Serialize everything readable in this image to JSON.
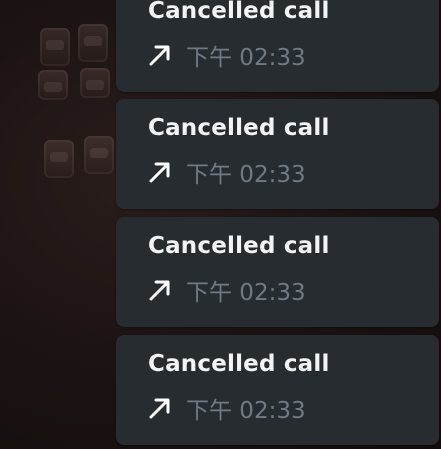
{
  "messages": [
    {
      "title": "Cancelled call",
      "time": "下午 02:33",
      "direction_icon": "outgoing-arrow-icon"
    },
    {
      "title": "Cancelled call",
      "time": "下午 02:33",
      "direction_icon": "outgoing-arrow-icon"
    },
    {
      "title": "Cancelled call",
      "time": "下午 02:33",
      "direction_icon": "outgoing-arrow-icon"
    },
    {
      "title": "Cancelled call",
      "time": "下午 02:33",
      "direction_icon": "outgoing-arrow-icon"
    }
  ],
  "colors": {
    "bubble_bg": "#272c31",
    "title_text": "#f2f4f6",
    "time_text": "#6f7a85",
    "arrow": "#ffffff"
  }
}
